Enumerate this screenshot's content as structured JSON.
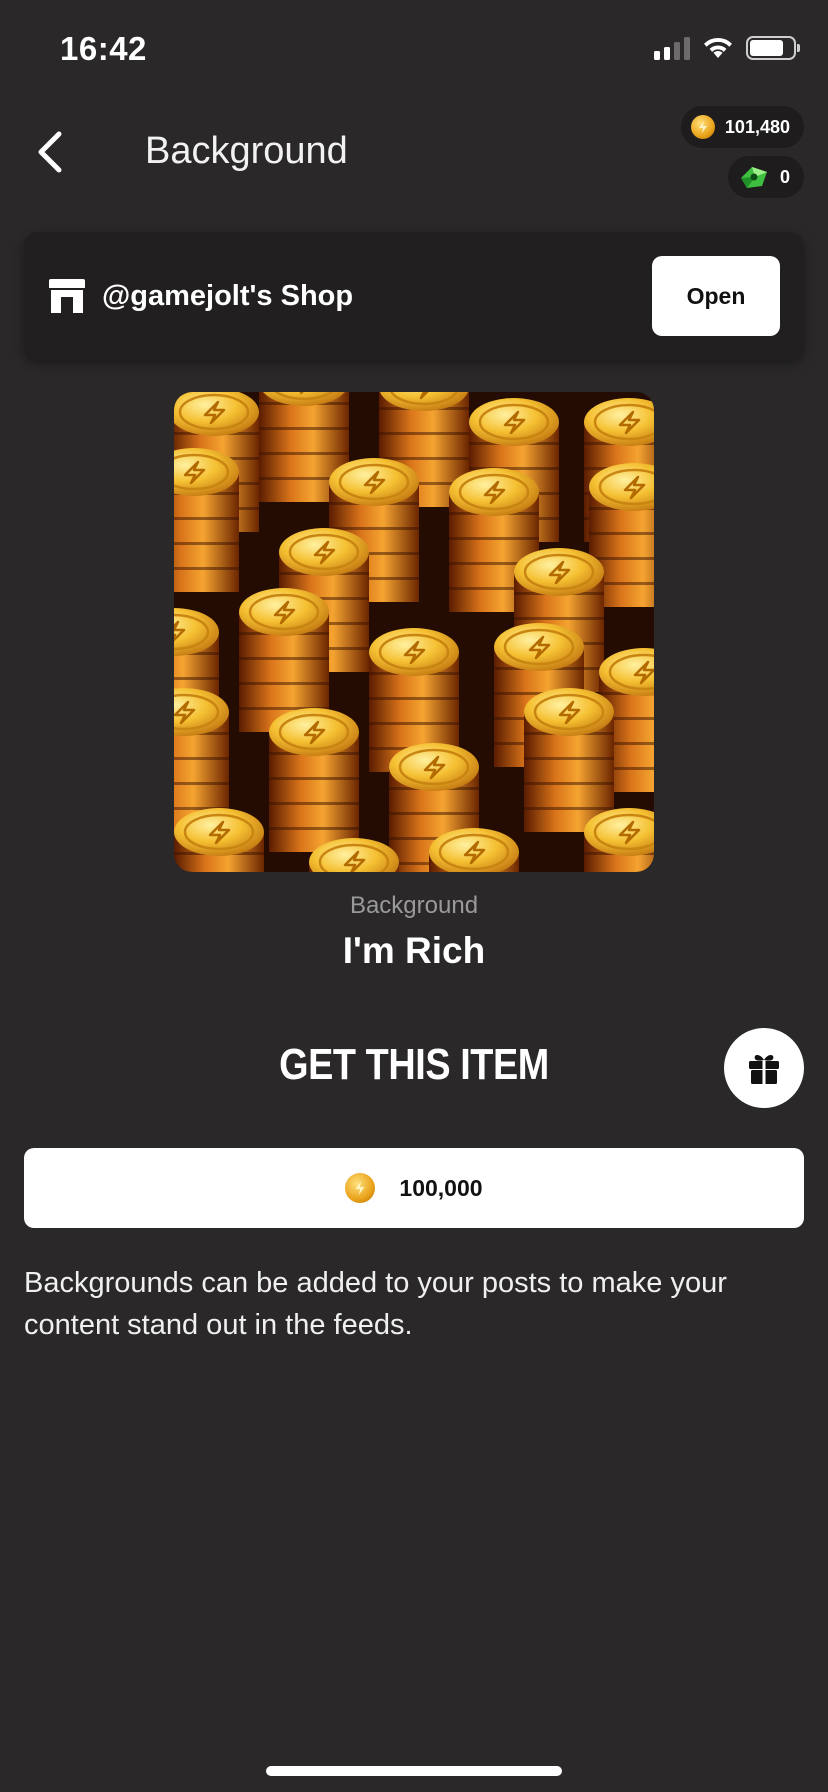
{
  "status_bar": {
    "time": "16:42"
  },
  "header": {
    "title": "Background",
    "coins_balance": "101,480",
    "gems_balance": "0"
  },
  "shop": {
    "name": "@gamejolt's Shop",
    "open_label": "Open"
  },
  "item": {
    "type": "Background",
    "name": "I'm Rich"
  },
  "purchase": {
    "title": "GET THIS ITEM",
    "price": "100,000"
  },
  "description": "Backgrounds can be added to your posts to make your content stand out in the feeds.",
  "colors": {
    "background": "#2a2829",
    "card": "#221f20",
    "coin": "#e9a21a",
    "gem": "#3fbf3f"
  },
  "icons": {
    "back": "chevron-left-icon",
    "shop": "storefront-icon",
    "gift": "gift-icon",
    "coin": "coin-icon",
    "gem": "gem-icon"
  }
}
